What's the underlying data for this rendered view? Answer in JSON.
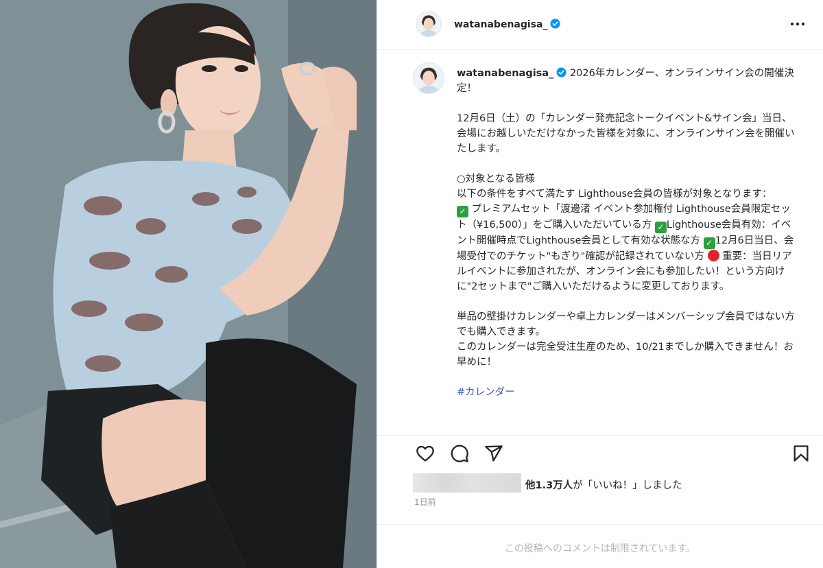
{
  "post": {
    "username": "watanabenagisa_",
    "verified": true
  },
  "caption": {
    "username": "watanabenagisa_",
    "line_title": "2026年カレンダー、オンラインサイン会の開催決定！",
    "para1": "12月6日（土）の「カレンダー発売記念トークイベント&サイン会」当日、会場にお越しいただけなかった皆様を対象に、オンラインサイン会を開催いたします。",
    "target_heading": "○対象となる皆様",
    "target_intro": "以下の条件をすべて満たす Lighthouse会員の皆様が対象となります：",
    "cond1": " プレミアムセット「渡邊渚 イベント参加権付 Lighthouse会員限定セット（¥16,500）」をご購入いただいている方 ",
    "cond2": "Lighthouse会員有効：イベント開催時点でLighthouse会員として有効な状態な方 ",
    "cond3": "12月6日当日、会場受付でのチケット\"もぎり\"確認が記録されていない方 ",
    "important": " 重要：当日リアルイベントに参加されたが、オンライン会にも参加したい！という方向けに\"2セットまで\"ご購入いただけるように変更しております。",
    "para3a": "単品の壁掛けカレンダーや卓上カレンダーはメンバーシップ会員ではない方でも購入できます。",
    "para3b": "このカレンダーは完全受注生産のため、10/21までしか購入できません！お早めに！",
    "hashtag": "#カレンダー"
  },
  "actions": {
    "like_icon": "heart-icon",
    "comment_icon": "comment-icon",
    "share_icon": "paper-plane-icon",
    "save_icon": "bookmark-icon"
  },
  "likes": {
    "count": "他1.3万人",
    "suffix": "が「いいね！」しました"
  },
  "timestamp": "1日前",
  "comments_disabled": "この投稿へのコメントは制限されています。",
  "colors": {
    "verified_blue": "#0095f6",
    "check_green": "#2e9e41",
    "red_dot": "#e0222a",
    "hashtag_blue": "#3b58c4"
  }
}
